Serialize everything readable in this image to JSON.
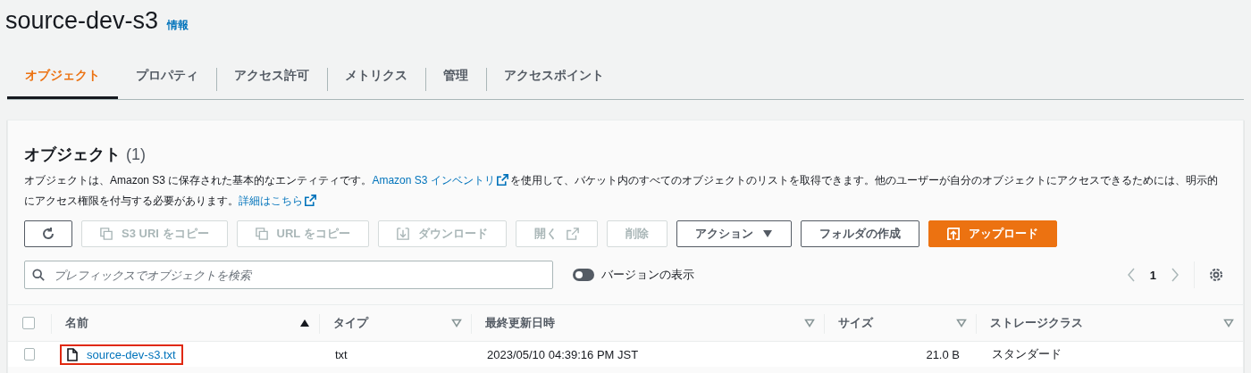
{
  "header": {
    "title": "source-dev-s3",
    "info_link": "情報"
  },
  "tabs": [
    {
      "label": "オブジェクト",
      "selected": true
    },
    {
      "label": "プロパティ",
      "selected": false
    },
    {
      "label": "アクセス許可",
      "selected": false
    },
    {
      "label": "メトリクス",
      "selected": false
    },
    {
      "label": "管理",
      "selected": false
    },
    {
      "label": "アクセスポイント",
      "selected": false
    }
  ],
  "panel": {
    "title": "オブジェクト",
    "count": "(1)",
    "description": [
      {
        "kind": "text",
        "text": "オブジェクトは、Amazon S3 に保存された基本的なエンティティです。"
      },
      {
        "kind": "link",
        "text": "Amazon S3 インベントリ"
      },
      {
        "kind": "text",
        "text": "を使用して、バケット内のすべてのオブジェクトのリストを取得できます。他のユーザーが自分のオブジェクトにアクセスできるためには、明示的にアクセス権限を付与する必要があります。"
      },
      {
        "kind": "link",
        "text": "詳細はこちら"
      }
    ],
    "buttons": [
      {
        "kind": "refresh",
        "disabled": false
      },
      {
        "kind": "copy",
        "label": "S3 URI をコピー",
        "disabled": true
      },
      {
        "kind": "copy",
        "label": "URL をコピー",
        "disabled": true
      },
      {
        "kind": "download",
        "label": "ダウンロード",
        "disabled": true
      },
      {
        "kind": "open",
        "label": "開く",
        "disabled": true
      },
      {
        "kind": "plain",
        "label": "削除",
        "disabled": true
      },
      {
        "kind": "dropdown",
        "label": "アクション",
        "disabled": false
      },
      {
        "kind": "plain",
        "label": "フォルダの作成",
        "disabled": false
      },
      {
        "kind": "upload",
        "label": "アップロード",
        "disabled": false
      }
    ],
    "search": {
      "placeholder": "プレフィックスでオブジェクトを検索"
    },
    "versions_toggle": {
      "label": "バージョンの表示",
      "on": false
    },
    "pagination": {
      "page": "1"
    }
  },
  "table": {
    "all_selected": false,
    "columns": [
      {
        "label": "名前",
        "sorted": true
      },
      {
        "label": "タイプ",
        "sorted": false
      },
      {
        "label": "最終更新日時",
        "sorted": false
      },
      {
        "label": "サイズ",
        "sorted": false
      },
      {
        "label": "ストレージクラス",
        "sorted": false
      }
    ],
    "rows": [
      {
        "selected": false,
        "highlighted": true,
        "name": "source-dev-s3.txt",
        "type": "txt",
        "modified": "2023/05/10 04:39:16 PM JST",
        "size": "21.0 B",
        "storage_class": "スタンダード"
      }
    ]
  }
}
